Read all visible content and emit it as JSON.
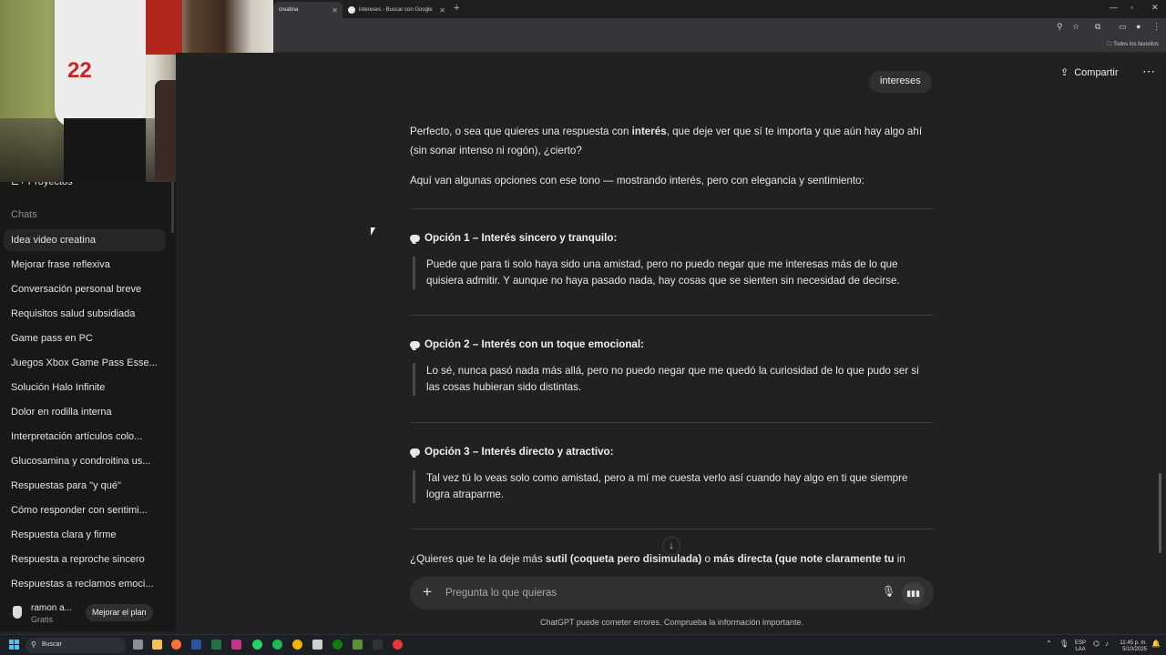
{
  "browser": {
    "tabs": [
      {
        "label": "creatina",
        "active": true
      },
      {
        "label": "intereses - Buscar con Google",
        "active": false
      }
    ],
    "new_tab": "+",
    "bookmarks_label": "Todos los favoritos"
  },
  "sidebar": {
    "projects_label": "Proyectos",
    "chats_header": "Chats",
    "chats": [
      "Idea video creatina",
      "Mejorar frase reflexiva",
      "Conversación personal breve",
      "Requisitos salud subsidiada",
      "Game pass en PC",
      "Juegos Xbox Game Pass Esse...",
      "Solución Halo Infinite",
      "Dolor en rodilla interna",
      "Interpretación artículos colo...",
      "Glucosamina y condroitina us...",
      "Respuestas para \"y qué\"",
      "Cómo responder con sentimi...",
      "Respuesta clara y firme",
      "Respuesta a reproche sincero",
      "Respuestas a reclamos emoci..."
    ],
    "user": {
      "name": "ramon a...",
      "plan": "Gratis",
      "upgrade_label": "Mejorar el plan"
    }
  },
  "header": {
    "share_label": "Compartir",
    "more_label": "⋯"
  },
  "conversation": {
    "user_message": "intereses",
    "intro_parts": {
      "a": "Perfecto, o sea que quieres una respuesta con ",
      "b": "interés",
      "c": ", que deje ver que sí te importa y que aún hay algo ahí (sin sonar intenso ni rogón), ¿cierto?"
    },
    "intro2": "Aquí van algunas opciones con ese tono — mostrando interés, pero con elegancia y sentimiento:",
    "options": [
      {
        "title": "Opción 1 – Interés sincero y tranquilo:",
        "text": "Puede que para ti solo haya sido una amistad, pero no puedo negar que me interesas más de lo que quisiera admitir. Y aunque no haya pasado nada, hay cosas que se sienten sin necesidad de decirse."
      },
      {
        "title": "Opción 2 – Interés con un toque emocional:",
        "text": "Lo sé, nunca pasó nada más allá, pero no puedo negar que me quedó la curiosidad de lo que pudo ser si las cosas hubieran sido distintas."
      },
      {
        "title": "Opción 3 – Interés directo y atractivo:",
        "text": "Tal vez tú lo veas solo como amistad, pero a mí me cuesta verlo así cuando hay algo en ti que siempre logra atraparme."
      }
    ],
    "closing_parts": {
      "a": "¿Quieres que te la deje más ",
      "b": "sutil (coqueta pero disimulada)",
      "c": " o ",
      "d": "más directa (que note claramente tu",
      "e": " in"
    }
  },
  "composer": {
    "placeholder": "Pregunta lo que quieras",
    "plus": "+"
  },
  "disclaimer": "ChatGPT puede cometer errores. Comprueba la información importante.",
  "taskbar": {
    "search_placeholder": "Buscar",
    "lang": "ESP",
    "lang2": "LAA",
    "time": "11:45 p. m.",
    "date": "5/10/2025"
  },
  "webcam": {
    "jersey_number": "22"
  },
  "colors": {
    "accent": "#4cc2ff",
    "background": "#212121",
    "sidebar": "#181818"
  }
}
